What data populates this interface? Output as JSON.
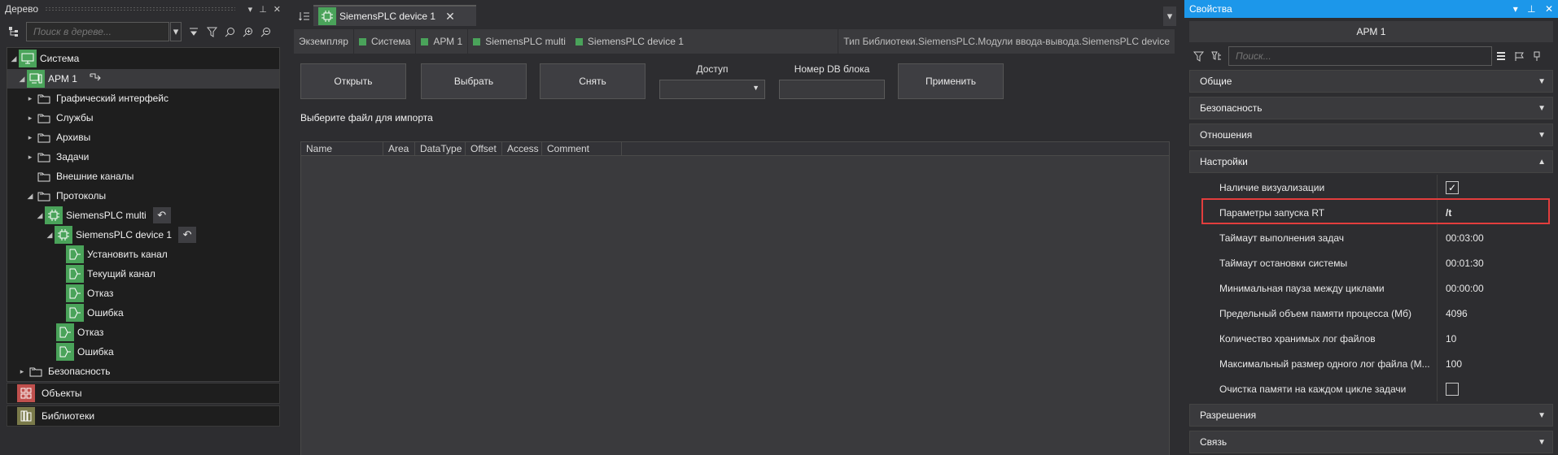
{
  "tree_panel": {
    "title": "Дерево",
    "search_placeholder": "Поиск в дереве...",
    "nodes": [
      {
        "label": "Система"
      },
      {
        "label": "АРМ 1"
      },
      {
        "label": "Графический интерфейс"
      },
      {
        "label": "Службы"
      },
      {
        "label": "Архивы"
      },
      {
        "label": "Задачи"
      },
      {
        "label": "Внешние каналы"
      },
      {
        "label": "Протоколы"
      },
      {
        "label": "SiemensPLC multi"
      },
      {
        "label": "SiemensPLC device 1"
      },
      {
        "label": "Установить канал"
      },
      {
        "label": "Текущий канал"
      },
      {
        "label": "Отказ"
      },
      {
        "label": "Ошибка"
      },
      {
        "label": "Отказ"
      },
      {
        "label": "Ошибка"
      },
      {
        "label": "Безопасность"
      }
    ],
    "sections": [
      {
        "label": "Объекты"
      },
      {
        "label": "Библиотеки"
      }
    ]
  },
  "editor": {
    "tab_title": "SiemensPLC device 1",
    "breadcrumbs": [
      {
        "label": "Экземпляр",
        "marker": false
      },
      {
        "label": "Система",
        "marker": true
      },
      {
        "label": "АРМ 1",
        "marker": true
      },
      {
        "label": "SiemensPLC multi",
        "marker": true
      },
      {
        "label": "SiemensPLC device 1",
        "marker": true
      }
    ],
    "type_path": "Тип Библиотеки.SiemensPLC.Модули ввода-вывода.SiemensPLC device",
    "buttons": {
      "open": "Открыть",
      "select": "Выбрать",
      "remove": "Снять",
      "apply": "Применить"
    },
    "access_label": "Доступ",
    "db_label": "Номер DB блока",
    "import_hint": "Выберите файл для импорта",
    "columns": [
      "Name",
      "Area",
      "DataType",
      "Offset",
      "Access",
      "Comment"
    ]
  },
  "props": {
    "title": "Свойства",
    "object": "АРМ 1",
    "search_placeholder": "Поиск...",
    "categories": {
      "general": "Общие",
      "security": "Безопасность",
      "relations": "Отношения",
      "settings": "Настройки",
      "permissions": "Разрешения",
      "link": "Связь"
    },
    "settings_rows": [
      {
        "name": "Наличие визуализации",
        "value": "",
        "checkbox": true,
        "checked": true
      },
      {
        "name": "Параметры запуска RT",
        "value": "/t"
      },
      {
        "name": "Таймаут выполнения задач",
        "value": "00:03:00"
      },
      {
        "name": "Таймаут остановки системы",
        "value": "00:01:30"
      },
      {
        "name": "Минимальная пауза между циклами",
        "value": "00:00:00"
      },
      {
        "name": "Предельный объем памяти процесса (Мб)",
        "value": "4096"
      },
      {
        "name": "Количество хранимых лог файлов",
        "value": "10"
      },
      {
        "name": "Максимальный размер одного лог файла (М...",
        "value": "100"
      },
      {
        "name": "Очистка памяти на каждом цикле задачи",
        "value": "",
        "checkbox": true,
        "checked": false
      }
    ]
  },
  "colors": {
    "accent": "#1c97ea",
    "node_green": "#4aa35a",
    "highlight": "#e23d3d"
  }
}
